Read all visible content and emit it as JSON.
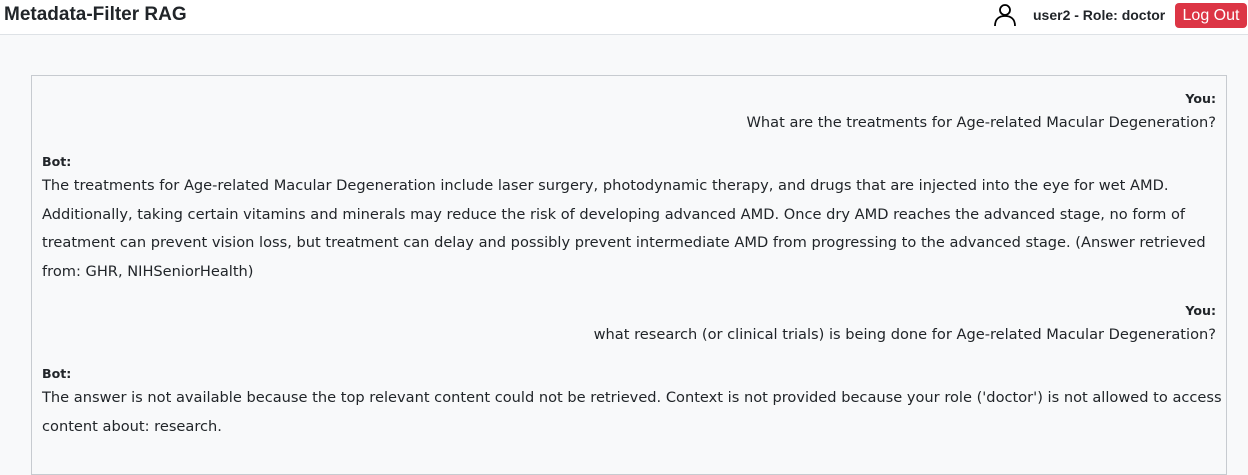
{
  "header": {
    "title": "Metadata-Filter RAG",
    "user_label": "user2 - Role: doctor",
    "user_icon": "user-icon",
    "logout_label": "Log Out",
    "logout_color": "#dc3545"
  },
  "chat": {
    "messages": [
      {
        "speaker": "You:",
        "text": "What are the treatments for Age-related Macular Degeneration?"
      },
      {
        "speaker": "Bot:",
        "text": "The treatments for Age-related Macular Degeneration include laser surgery, photodynamic therapy, and drugs that are injected into the eye for wet AMD. Additionally, taking certain vitamins and minerals may reduce the risk of developing advanced AMD. Once dry AMD reaches the advanced stage, no form of treatment can prevent vision loss, but treatment can delay and possibly prevent intermediate AMD from progressing to the advanced stage. (Answer retrieved from: GHR, NIHSeniorHealth)"
      },
      {
        "speaker": "You:",
        "text": "what research (or clinical trials) is being done for Age-related Macular Degeneration?"
      },
      {
        "speaker": "Bot:",
        "text": "The answer is not available because the top relevant content could not be retrieved. Context is not provided because your role ('doctor') is not allowed to access content about: research."
      }
    ]
  }
}
